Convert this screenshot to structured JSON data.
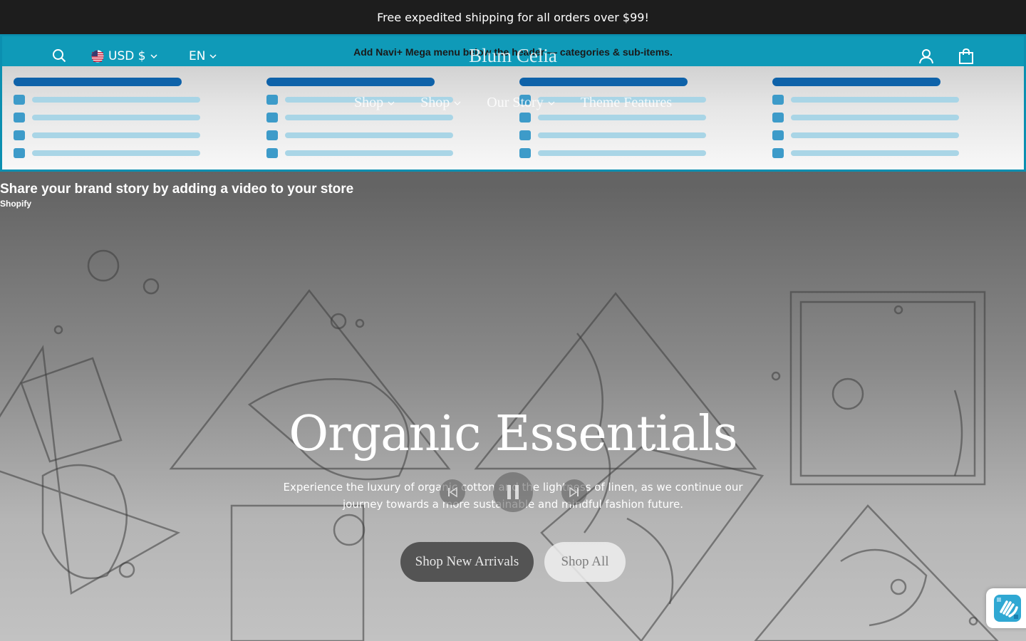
{
  "announcement": "Free expedited shipping for all orders over $99!",
  "header": {
    "currency": "USD $",
    "language": "EN",
    "notice": "Add Navi+ Mega menu below the header — categories & sub-items.",
    "logo": "Blum Celia",
    "nav": [
      "Shop",
      "Shop",
      "Our Story",
      "Theme Features"
    ]
  },
  "video": {
    "title": "Share your brand story by adding a video to your store",
    "source": "Shopify"
  },
  "hero": {
    "title": "Organic Essentials",
    "text": "Experience the luxury of organic cotton and the lightness of linen, as we continue our journey towards a more sustainable and mindful fashion future.",
    "primary_button": "Shop New Arrivals",
    "secondary_button": "Shop All"
  },
  "colors": {
    "header_bar": "#0f9ab8",
    "mega_heading": "#0e62a9",
    "mega_square": "#3d9bc9",
    "mega_line": "#a9d5e6"
  },
  "icons": [
    "search-icon",
    "us-flag-icon",
    "chevron-down-icon",
    "account-icon",
    "cart-icon",
    "prev-icon",
    "pause-icon",
    "next-icon",
    "accessibility-icon"
  ]
}
